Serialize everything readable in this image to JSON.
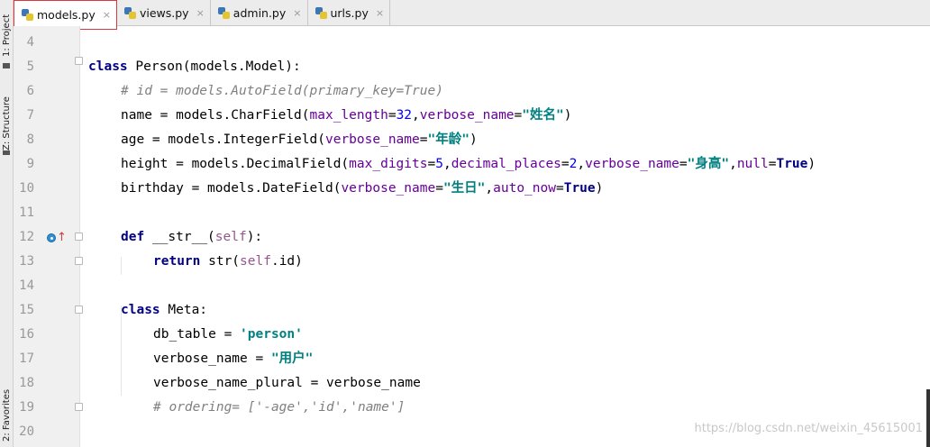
{
  "side_strip": {
    "project_label": "1: Project",
    "structure_label": "Z: Structure",
    "favorites_label": "2: Favorites"
  },
  "tabs": [
    {
      "label": "models.py",
      "active": true,
      "icon": "python-file-icon"
    },
    {
      "label": "views.py",
      "active": false,
      "icon": "python-file-icon"
    },
    {
      "label": "admin.py",
      "active": false,
      "icon": "python-file-icon"
    },
    {
      "label": "urls.py",
      "active": false,
      "icon": "python-file-icon"
    }
  ],
  "tab_close_glyph": "×",
  "line_numbers": [
    "4",
    "5",
    "6",
    "7",
    "8",
    "9",
    "10",
    "11",
    "12",
    "13",
    "14",
    "15",
    "16",
    "17",
    "18",
    "19",
    "20"
  ],
  "code": {
    "l5": {
      "kw": "class",
      "rest": " Person(models.Model):"
    },
    "l6": {
      "comment": "# id = models.AutoField(primary_key=True)"
    },
    "l7": {
      "a": "name = models.CharField(",
      "p1": "max_length",
      "eq1": "=",
      "n1": "32",
      "c1": ",",
      "p2": "verbose_name",
      "eq2": "=",
      "s1": "\"姓名\"",
      "end": ")"
    },
    "l8": {
      "a": "age = models.IntegerField(",
      "p1": "verbose_name",
      "eq1": "=",
      "s1": "\"年龄\"",
      "end": ")"
    },
    "l9": {
      "a": "height = models.DecimalField(",
      "p1": "max_digits",
      "eq1": "=",
      "n1": "5",
      "c1": ",",
      "p2": "decimal_places",
      "eq2": "=",
      "n2": "2",
      "c2": ",",
      "p3": "verbose_name",
      "eq3": "=",
      "s1": "\"身高\"",
      "c3": ",",
      "p4": "null",
      "eq4": "=",
      "k1": "True",
      "end": ")"
    },
    "l10": {
      "a": "birthday = models.DateField(",
      "p1": "verbose_name",
      "eq1": "=",
      "s1": "\"生日\"",
      "c1": ",",
      "p2": "auto_now",
      "eq2": "=",
      "k1": "True",
      "end": ")"
    },
    "l12": {
      "kw": "def",
      "sp": " ",
      "fn": "__str__",
      "open": "(",
      "self": "self",
      "close": "):"
    },
    "l13": {
      "kw": "return",
      "a": " str(",
      "self": "self",
      "b": ".id)"
    },
    "l15": {
      "kw": "class",
      "rest": " Meta:"
    },
    "l16": {
      "a": "db_table = ",
      "s1": "'person'"
    },
    "l17": {
      "a": "verbose_name = ",
      "s1": "\"用户\""
    },
    "l18": {
      "a": "verbose_name_plural = verbose_name"
    },
    "l19": {
      "comment": "# ordering= ['-age','id','name']"
    }
  },
  "watermark": "https://blog.csdn.net/weixin_45615001",
  "colors": {
    "keyword": "#000080",
    "comment": "#808080",
    "param": "#660099",
    "number": "#0000ff",
    "string": "#008080",
    "active_tab_border": "#d9363e"
  }
}
